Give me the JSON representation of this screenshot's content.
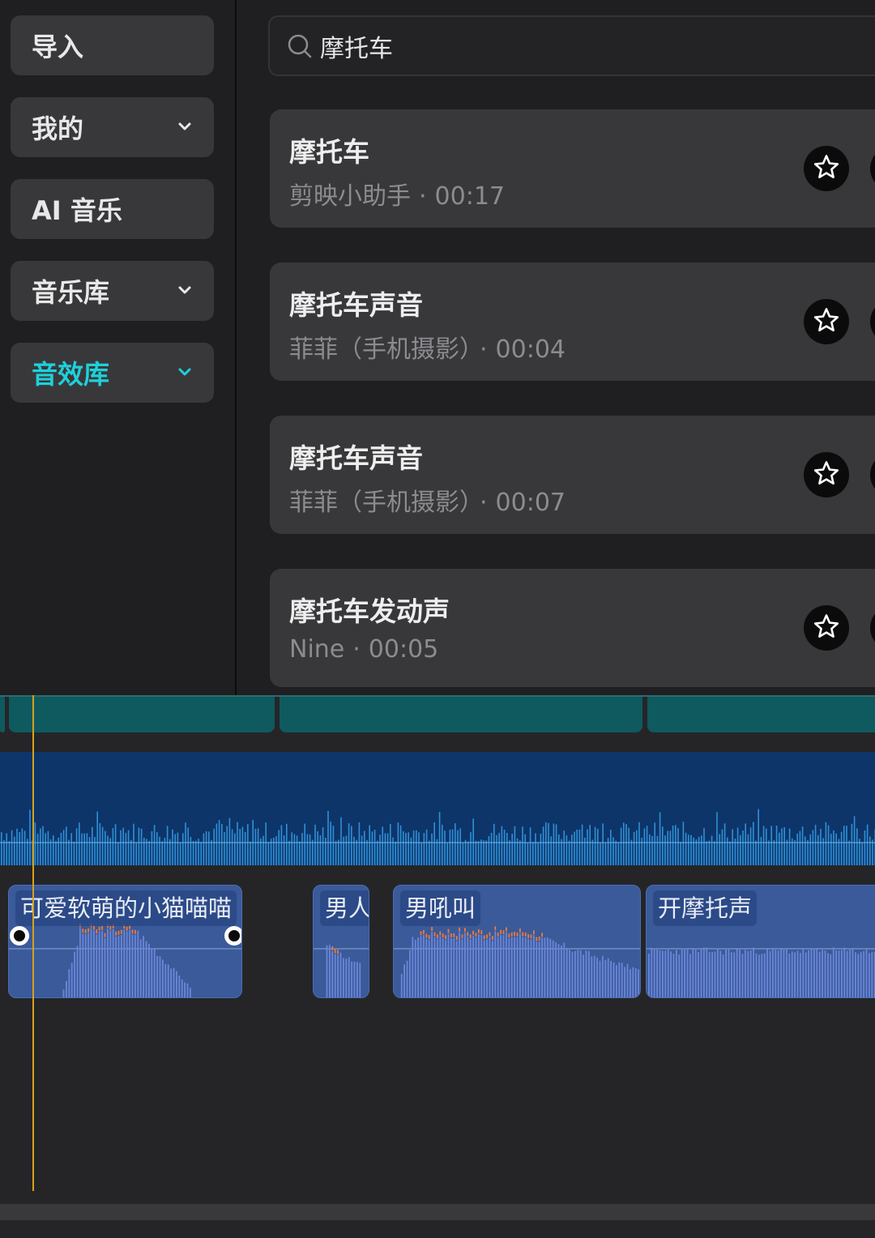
{
  "sidebar": {
    "items": [
      {
        "label": "导入",
        "has_chevron": false,
        "active": false
      },
      {
        "label": "我的",
        "has_chevron": true,
        "active": false
      },
      {
        "label": "AI 音乐",
        "has_chevron": false,
        "active": false
      },
      {
        "label": "音乐库",
        "has_chevron": true,
        "active": false
      },
      {
        "label": "音效库",
        "has_chevron": true,
        "active": true
      }
    ]
  },
  "search": {
    "value": "摩托车",
    "icon": "search-icon"
  },
  "results": [
    {
      "title": "摩托车",
      "author": "剪映小助手",
      "separator": "·",
      "duration": "00:17",
      "icon": "star-icon"
    },
    {
      "title": "摩托车声音",
      "author": "菲菲（手机摄影）",
      "separator": "·",
      "duration": "00:04",
      "icon": "star-icon"
    },
    {
      "title": "摩托车声音",
      "author": "菲菲（手机摄影）",
      "separator": "·",
      "duration": "00:07",
      "icon": "star-icon"
    },
    {
      "title": "摩托车发动声",
      "author": "Nine",
      "separator": "·",
      "duration": "00:05",
      "icon": "star-icon"
    }
  ],
  "timeline": {
    "clips": [
      {
        "label": "可爱软萌的小猫喵喵"
      },
      {
        "label": "男人"
      },
      {
        "label": "男吼叫"
      },
      {
        "label": "开摩托声"
      }
    ]
  },
  "colors": {
    "accent": "#1fd0da",
    "playhead": "#d6a21a",
    "main_track": "#0d3569",
    "sfx_clip": "#3a5a9a",
    "teal_clip": "#0e5a5f"
  }
}
